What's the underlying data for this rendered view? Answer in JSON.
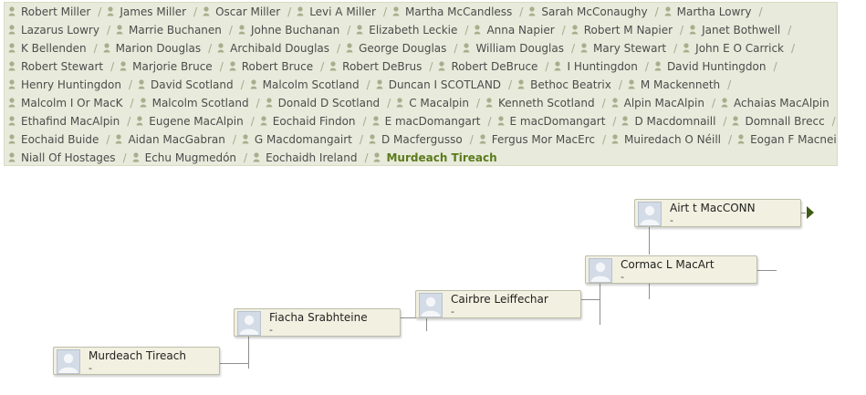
{
  "breadcrumb_rows": [
    [
      "Robert Miller",
      "James Miller",
      "Oscar Miller",
      "Levi A Miller",
      "Martha McCandless",
      "Sarah McConaughy",
      "Martha Lowry"
    ],
    [
      "Lazarus Lowry",
      "Marrie Buchanen",
      "Johne Buchanan",
      "Elizabeth Leckie",
      "Anna Napier",
      "Robert M Napier",
      "Janet Bothwell"
    ],
    [
      "K Bellenden",
      "Marion Douglas",
      "Archibald Douglas",
      "George Douglas",
      "William Douglas",
      "Mary Stewart",
      "John E O Carrick"
    ],
    [
      "Robert Stewart",
      "Marjorie Bruce",
      "Robert Bruce",
      "Robert DeBrus",
      "Robert DeBruce",
      "I Huntingdon",
      "David Huntingdon"
    ],
    [
      "Henry Huntingdon",
      "David Scotland",
      "Malcolm Scotland",
      "Duncan I SCOTLAND",
      "Bethoc Beatrix",
      "M Mackenneth"
    ],
    [
      "Malcolm I Or MacK",
      "Malcolm Scotland",
      "Donald D Scotland",
      "C Macalpin",
      "Kenneth Scotland",
      "Alpin MacAlpin",
      "Achaias MacAlpin"
    ],
    [
      "Ethafind MacAlpin",
      "Eugene MacAlpin",
      "Eochaid Findon",
      "E macDomangart",
      "E macDomangart",
      "D Macdomnaill",
      "Domnall Brecc"
    ],
    [
      "Eochaid Buide",
      "Aidan MacGabran",
      "G Macdomangairt",
      "D Macfergusso",
      "Fergus Mor MacErc",
      "Muiredach O Néill",
      "Eogan F Macnei"
    ],
    [
      "Niall Of Hostages",
      "Echu Mugmedón",
      "Eochaidh Ireland",
      "Murdeach Tireach"
    ]
  ],
  "current_person": "Murdeach Tireach",
  "tree_people": [
    {
      "name": "Murdeach Tireach",
      "dates": "-"
    },
    {
      "name": "Fiacha Srabhteine",
      "dates": "-"
    },
    {
      "name": "Cairbre Leiffechar",
      "dates": "-"
    },
    {
      "name": "Cormac L MacArt",
      "dates": "-"
    },
    {
      "name": "Airt t MacCONN",
      "dates": "-"
    }
  ],
  "colors": {
    "breadcrumb_bg": "#e8eadb",
    "current_link": "#5b7a1c",
    "card_bg": "#f2f0e0",
    "arrow": "#3f5a14"
  },
  "icons": {
    "breadcrumb": "person-pin-icon",
    "avatar": "person-silhouette-icon",
    "expand": "arrow-right-icon"
  }
}
